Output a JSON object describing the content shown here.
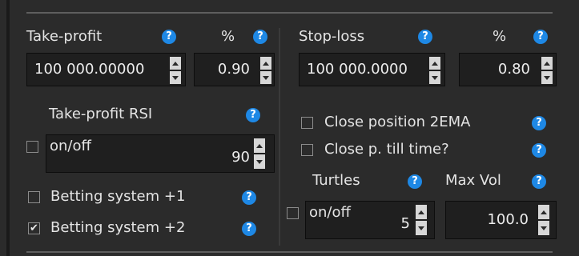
{
  "take_profit": {
    "label": "Take-profit",
    "percent_label": "%",
    "value": "100 000.00000",
    "percent_value": "0.90",
    "rsi_label": "Take-profit RSI",
    "rsi_toggle_label": "on/off",
    "rsi_value": "90"
  },
  "stop_loss": {
    "label": "Stop-loss",
    "percent_label": "%",
    "value": "100 000.0000",
    "percent_value": "0.80"
  },
  "options": {
    "betting_1_label": "Betting system +1",
    "betting_1_checked": false,
    "betting_2_label": "Betting system +2",
    "betting_2_checked": true,
    "close_2ema_label": "Close position 2EMA",
    "close_2ema_checked": false,
    "close_time_label": "Close p. till time?",
    "close_time_checked": false
  },
  "turtles": {
    "label": "Turtles",
    "toggle_label": "on/off",
    "value": "5",
    "max_vol_label": "Max Vol",
    "max_vol_value": "100.0"
  },
  "help_glyph": "?",
  "check_glyph": "✔",
  "colors": {
    "background": "#2b2b2b",
    "field_bg": "#1f1f1f",
    "help_icon": "#1e88e5",
    "spin_button": "#d7d7d7"
  }
}
